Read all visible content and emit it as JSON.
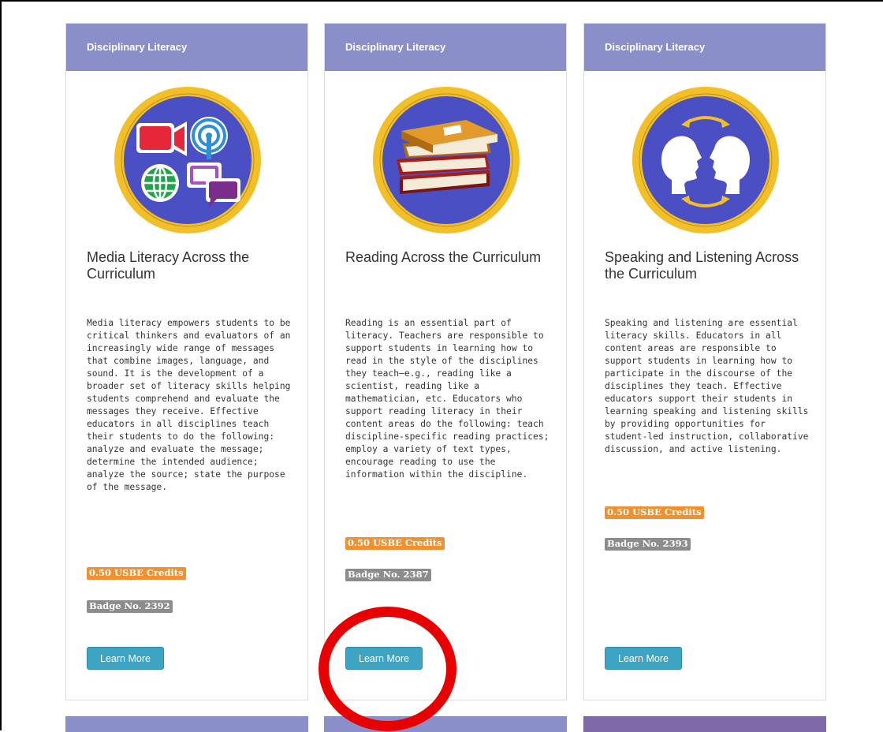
{
  "cards": [
    {
      "category": "Disciplinary Literacy",
      "title": "Media Literacy Across the Curriculum",
      "description": "Media literacy empowers students to be critical thinkers and evaluators of an increasingly wide range of messages that combine images, language, and sound. It is the development of a broader set of literacy skills helping students comprehend and evaluate the messages they receive. Effective educators in all disciplines teach their students to do the following: analyze and evaluate the message; determine the intended audience; analyze the source; state the purpose of the message.",
      "credits": "0.50 USBE Credits",
      "badge_no": "Badge No. 2392",
      "button": "Learn More",
      "icon": "media-literacy-icon"
    },
    {
      "category": "Disciplinary Literacy",
      "title": "Reading Across the Curriculum",
      "description": "Reading is an essential part of literacy. Teachers are responsible to support students in learning how to read in the style of the disciplines they teach—e.g., reading like a scientist, reading like a mathematician, etc. Educators who support reading literacy in their content areas do the following: teach discipline-specific reading practices; employ a variety of text types, encourage reading to use the information within the discipline.",
      "credits": "0.50 USBE Credits",
      "badge_no": "Badge No. 2387",
      "button": "Learn More",
      "icon": "books-icon"
    },
    {
      "category": "Disciplinary Literacy",
      "title": "Speaking and Listening Across the Curriculum",
      "description": "Speaking and listening are essential literacy skills. Educators in all content areas are responsible to support students in learning how to participate in the discourse of the disciplines they teach. Effective educators support their students in learning speaking and listening skills by providing opportunities for student-led instruction, collaborative discussion, and active listening.",
      "credits": "0.50 USBE Credits",
      "badge_no": "Badge No. 2393",
      "button": "Learn More",
      "icon": "speaking-listening-icon"
    }
  ],
  "colors": {
    "header": "#8a8ec9",
    "credits": "#f0902e",
    "badge_no": "#8c8c8c",
    "button": "#3ea4c4",
    "badge_ring": "#f2bf26",
    "badge_fill": "#4a4fc4",
    "highlight": "#e80000",
    "next_card_purple": "#7d6aa6"
  }
}
